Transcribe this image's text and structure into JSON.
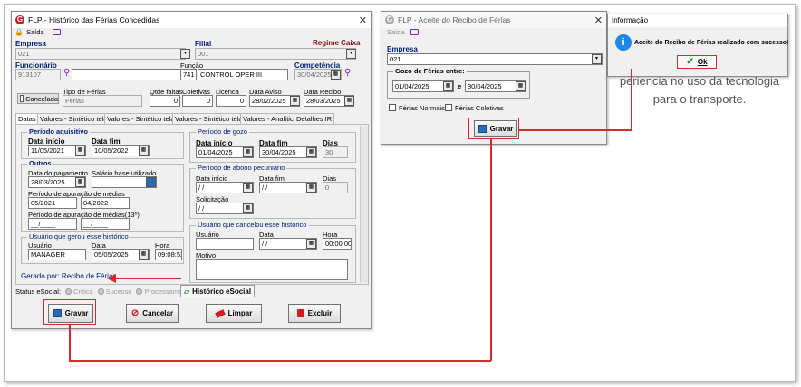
{
  "main_window": {
    "title": "FLP - Histórico das Férias Concedidas",
    "saida": "Saída",
    "empresa_label": "Empresa",
    "empresa_value": "021",
    "filial_label": "Filial",
    "filial_value": "001",
    "regime_caixa": "Regime Caixa",
    "funcionario_label": "Funcionário",
    "funcionario_value": "913107",
    "funcao_label": "Função",
    "funcao_code": "741",
    "funcao_desc": "CONTROL OPER III",
    "competencia_label": "Competência",
    "competencia_value": "30/04/2025",
    "cancelada": "Cancelada",
    "tipo_ferias_label": "Tipo de Férias",
    "tipo_ferias_value": "Férias",
    "qtde_faltas_label": "Qtde faltas",
    "qtde_faltas_value": "0",
    "coletivas_label": "Coletivas",
    "coletivas_value": "0",
    "licenca_label": "Licenca",
    "licenca_value": "0",
    "data_aviso_label": "Data Aviso",
    "data_aviso_value": "28/02/2025",
    "data_recibo_label": "Data Recibo",
    "data_recibo_value": "28/03/2025",
    "tabs": [
      "Datas",
      "Valores - Sintético tela 1",
      "Valores - Sintético tela 2",
      "Valores - Sintético tela 3",
      "Valores - Analítico",
      "Detalhes IR"
    ],
    "periodo_aquisitivo": {
      "title": "Período aquisitivo",
      "inicio_label": "Data início",
      "inicio": "11/05/2021",
      "fim_label": "Data fim",
      "fim": "10/05/2022"
    },
    "outros": {
      "title": "Outros",
      "pagamento_label": "Data do pagamento",
      "pagamento": "28/03/2025",
      "salario_label": "Salário base utilizado",
      "apuracao_label": "Período de apuração de médias",
      "apuracao_ini": "05/2021",
      "apuracao_fim": "04/2022",
      "apuracao13_label": "Período de apuração de médias(13º)",
      "apuracao13_ini": "__/____",
      "apuracao13_fim": "__/____"
    },
    "usuario_gerou": {
      "title": "Usuário que gerou esse histórico",
      "usuario_label": "Usuário",
      "usuario": "MANAGER",
      "data_label": "Data",
      "data": "05/05/2025",
      "hora_label": "Hora",
      "hora": "09:08:52"
    },
    "gerado_por": "Gerado por: Recibo de Férias",
    "periodo_gozo": {
      "title": "Período de gozo",
      "inicio_label": "Data início",
      "inicio": "01/04/2025",
      "fim_label": "Data fim",
      "fim": "30/04/2025",
      "dias_label": "Dias",
      "dias": "30"
    },
    "abono": {
      "title": "Período de abono pecuniário",
      "inicio_label": "Data início",
      "inicio": " / /",
      "fim_label": "Data fim",
      "fim": " / /",
      "dias_label": "Dias",
      "dias": "0",
      "solicitacao_label": "Solicitação",
      "solicitacao": " / /"
    },
    "usuario_cancelou": {
      "title": "Usuário que cancelou esse histórico",
      "usuario_label": "Usuário",
      "data_label": "Data",
      "data": " / /",
      "hora_label": "Hora",
      "hora": "00:00:00",
      "motivo_label": "Motivo"
    },
    "status_esocial": "Status eSocial:",
    "status_critica": "Crítica",
    "status_sucesso": "Sucesso",
    "status_processamento": "Processamento",
    "historico_esocial": "Histórico eSocial",
    "buttons": {
      "gravar": "Gravar",
      "cancelar": "Cancelar",
      "limpar": "Limpar",
      "excluir": "Excluir"
    }
  },
  "aceite_window": {
    "title": "FLP - Aceite do Recibo de Férias",
    "saida": "Saída",
    "empresa_label": "Empresa",
    "empresa_value": "021",
    "gozo_title": "Gozo de Férias entre:",
    "gozo_ini": "01/04/2025",
    "e": "e",
    "gozo_fim": "30/04/2025",
    "ferias_normais": "Férias Normais",
    "ferias_coletivas": "Férias Coletivas",
    "gravar": "Gravar"
  },
  "info_dialog": {
    "title": "Informação",
    "message": "Aceite do Recibo de Férias realizado com sucesso!",
    "ok": "Ok"
  },
  "background_text": {
    "line1": "periencia no uso da tecnologia",
    "line2": "para o transporte."
  },
  "colors": {
    "annotation_red": "#d72a2a",
    "label_blue": "#00207a",
    "brand_red": "#d71920"
  }
}
